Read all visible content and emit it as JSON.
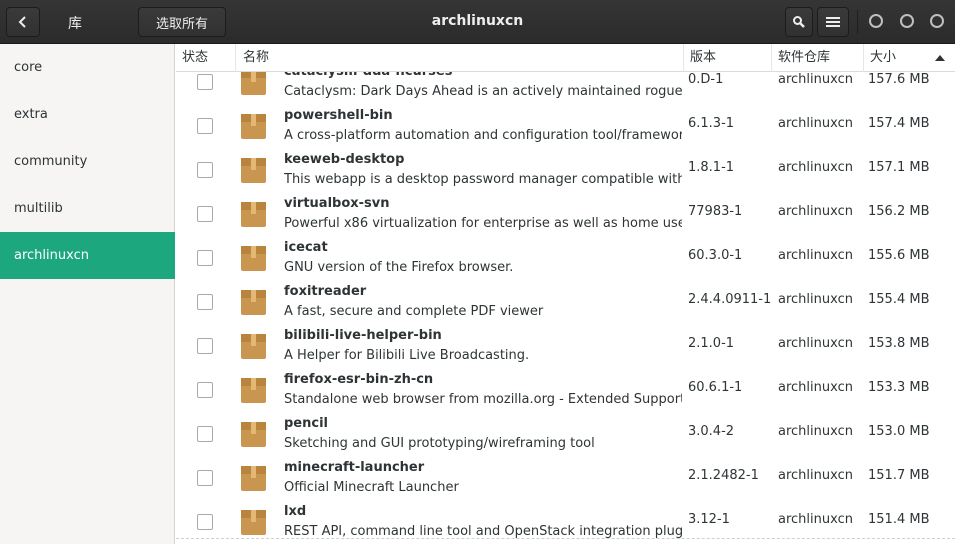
{
  "header": {
    "back_icon": "chevron-left-icon",
    "section_title": "库",
    "select_all_label": "选取所有",
    "title": "archlinuxcn",
    "search_icon": "search-icon",
    "menu_icon": "hamburger-menu-icon"
  },
  "sidebar": {
    "items": [
      {
        "label": "core",
        "active": false
      },
      {
        "label": "extra",
        "active": false
      },
      {
        "label": "community",
        "active": false
      },
      {
        "label": "multilib",
        "active": false
      },
      {
        "label": "archlinuxcn",
        "active": true
      }
    ],
    "active_color": "#1da77e"
  },
  "table": {
    "headers": {
      "status": "状态",
      "name": "名称",
      "version": "版本",
      "repo": "软件仓库",
      "size": "大小"
    },
    "rows": [
      {
        "name": "cataclysm-dda-ncurses",
        "desc": "Cataclysm: Dark Days Ahead is an actively maintained roguelike sc",
        "version": "0.D-1",
        "repo": "archlinuxcn",
        "size": "157.6 MB"
      },
      {
        "name": "powershell-bin",
        "desc": "A cross-platform automation and configuration tool/framework (b",
        "version": "6.1.3-1",
        "repo": "archlinuxcn",
        "size": "157.4 MB"
      },
      {
        "name": "keeweb-desktop",
        "desc": "This webapp is a desktop password manager compatible with KeeP",
        "version": "1.8.1-1",
        "repo": "archlinuxcn",
        "size": "157.1 MB"
      },
      {
        "name": "virtualbox-svn",
        "desc": "Powerful x86 virtualization for enterprise as well as home use",
        "version": "77983-1",
        "repo": "archlinuxcn",
        "size": "156.2 MB"
      },
      {
        "name": "icecat",
        "desc": "GNU version of the Firefox browser.",
        "version": "60.3.0-1",
        "repo": "archlinuxcn",
        "size": "155.6 MB"
      },
      {
        "name": "foxitreader",
        "desc": "A fast, secure and complete PDF viewer",
        "version": "2.4.4.0911-1",
        "repo": "archlinuxcn",
        "size": "155.4 MB"
      },
      {
        "name": "bilibili-live-helper-bin",
        "desc": "A Helper for Bilibili Live Broadcasting.",
        "version": "2.1.0-1",
        "repo": "archlinuxcn",
        "size": "153.8 MB"
      },
      {
        "name": "firefox-esr-bin-zh-cn",
        "desc": "Standalone web browser from mozilla.org - Extended Support Rele",
        "version": "60.6.1-1",
        "repo": "archlinuxcn",
        "size": "153.3 MB"
      },
      {
        "name": "pencil",
        "desc": "Sketching and GUI prototyping/wireframing tool",
        "version": "3.0.4-2",
        "repo": "archlinuxcn",
        "size": "153.0 MB"
      },
      {
        "name": "minecraft-launcher",
        "desc": "Official Minecraft Launcher",
        "version": "2.1.2482-1",
        "repo": "archlinuxcn",
        "size": "151.7 MB"
      },
      {
        "name": "lxd",
        "desc": "REST API, command line tool and OpenStack integration plugin for",
        "version": "3.12-1",
        "repo": "archlinuxcn",
        "size": "151.4 MB"
      }
    ],
    "row_icon": "package-icon",
    "sort_icon": "sort-ascending-icon"
  }
}
